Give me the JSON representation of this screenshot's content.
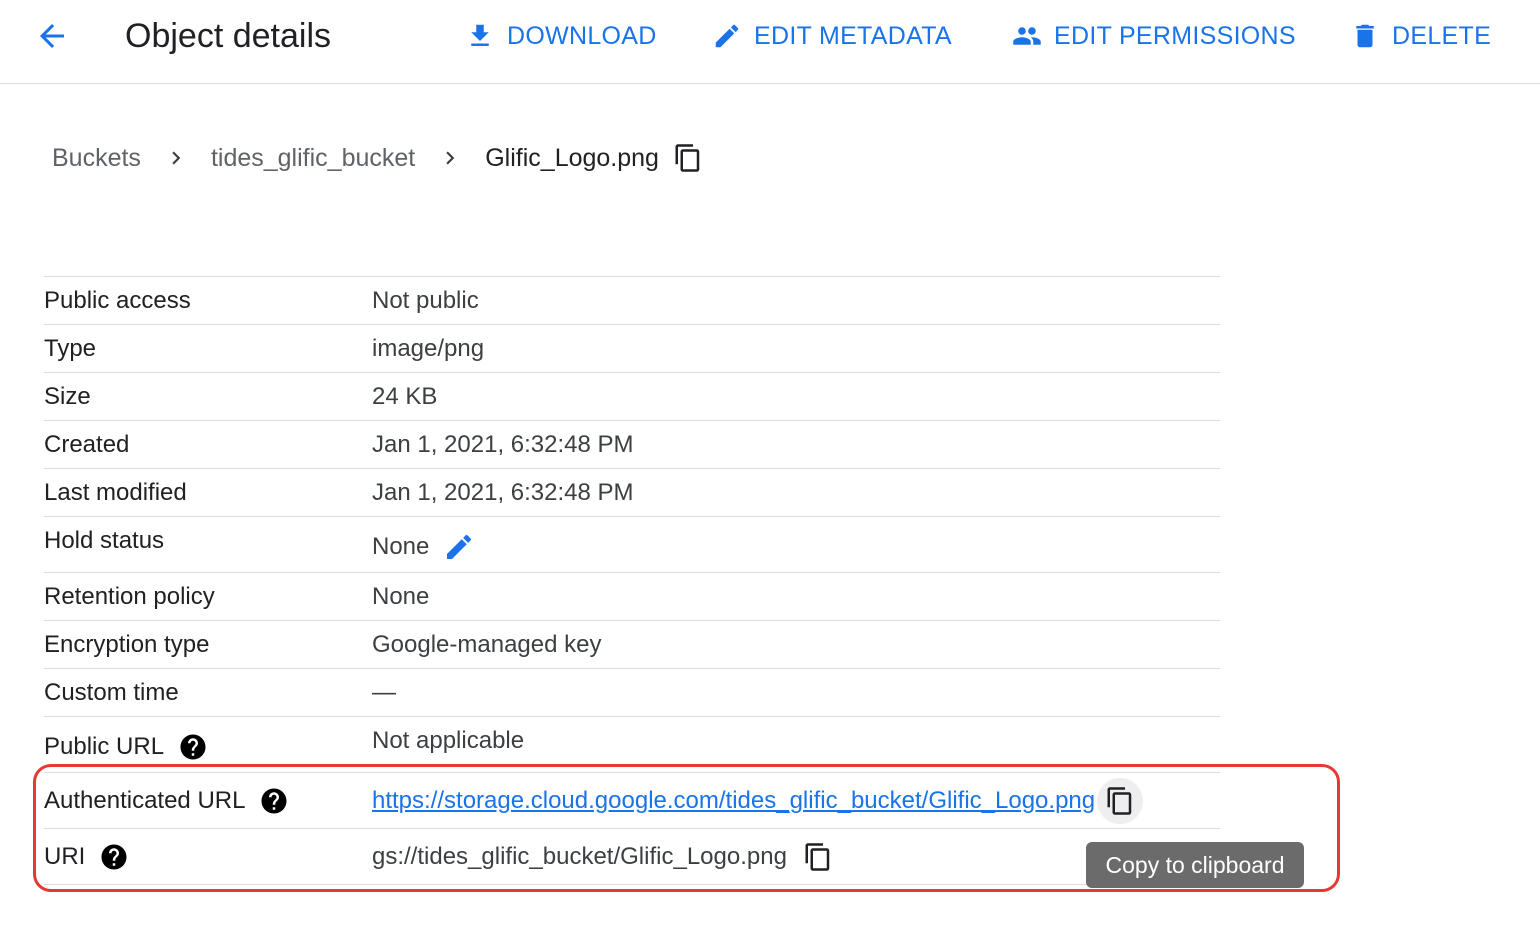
{
  "header": {
    "title": "Object details",
    "actions": {
      "download": "DOWNLOAD",
      "edit_metadata": "EDIT METADATA",
      "edit_permissions": "EDIT PERMISSIONS",
      "delete": "DELETE"
    }
  },
  "breadcrumb": {
    "items": [
      "Buckets",
      "tides_glific_bucket"
    ],
    "current": "Glific_Logo.png"
  },
  "details": {
    "public_access": {
      "label": "Public access",
      "value": "Not public"
    },
    "type": {
      "label": "Type",
      "value": "image/png"
    },
    "size": {
      "label": "Size",
      "value": "24 KB"
    },
    "created": {
      "label": "Created",
      "value": "Jan 1, 2021, 6:32:48 PM"
    },
    "last_modified": {
      "label": "Last modified",
      "value": "Jan 1, 2021, 6:32:48 PM"
    },
    "hold_status": {
      "label": "Hold status",
      "value": "None"
    },
    "retention_policy": {
      "label": "Retention policy",
      "value": "None"
    },
    "encryption_type": {
      "label": "Encryption type",
      "value": "Google-managed key"
    },
    "custom_time": {
      "label": "Custom time",
      "value": "—"
    },
    "public_url": {
      "label": "Public URL",
      "value": "Not applicable"
    },
    "authenticated_url": {
      "label": "Authenticated URL",
      "value": "https://storage.cloud.google.com/tides_glific_bucket/Glific_Logo.png"
    },
    "uri": {
      "label": "URI",
      "value": "gs://tides_glific_bucket/Glific_Logo.png"
    }
  },
  "tooltip": {
    "text": "Copy to clipboard"
  },
  "colors": {
    "accent": "#1a73e8",
    "highlight": "#e53935",
    "tooltip_bg": "#6b6b6b"
  },
  "icons": [
    "arrow-back-icon",
    "download-icon",
    "pencil-icon",
    "people-icon",
    "trash-icon",
    "chevron-right-icon",
    "copy-icon",
    "help-icon"
  ]
}
